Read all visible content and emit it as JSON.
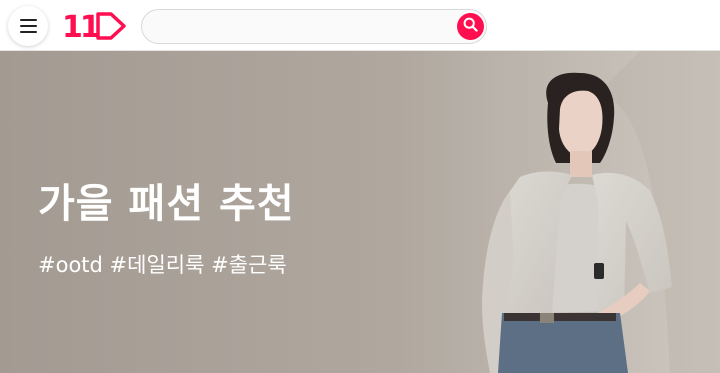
{
  "header": {
    "menu_icon": "hamburger-menu-icon",
    "logo_text": "11",
    "brand_color": "#ff0f4f",
    "search": {
      "placeholder": "",
      "value": "",
      "button_icon": "search-icon"
    }
  },
  "banner": {
    "title": "가을 패션 추천",
    "tags": "#ootd #데일리룩 #출근룩"
  }
}
